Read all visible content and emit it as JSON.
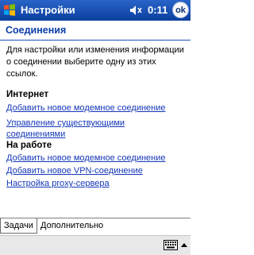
{
  "titlebar": {
    "title": "Настройки",
    "clock": "0:11",
    "ok_label": "ok"
  },
  "section": {
    "title": "Соединения"
  },
  "intro": "Для настройки или изменения информации о соединении выберите одну из этих ссылок.",
  "groups": [
    {
      "heading": "Интернет",
      "links": [
        "Добавить новое модемное соединение",
        "Управление существующими соединениями"
      ]
    },
    {
      "heading": "На работе",
      "links": [
        "Добавить новое модемное соединение",
        "Добавить новое VPN-соединение",
        "Настройка proxy-сервера"
      ]
    }
  ],
  "tabs": [
    "Задачи",
    "Дополнительно"
  ],
  "colors": {
    "titlebar": "#0b3f9e",
    "link": "#1537b8",
    "section_title": "#0b3ea8"
  }
}
